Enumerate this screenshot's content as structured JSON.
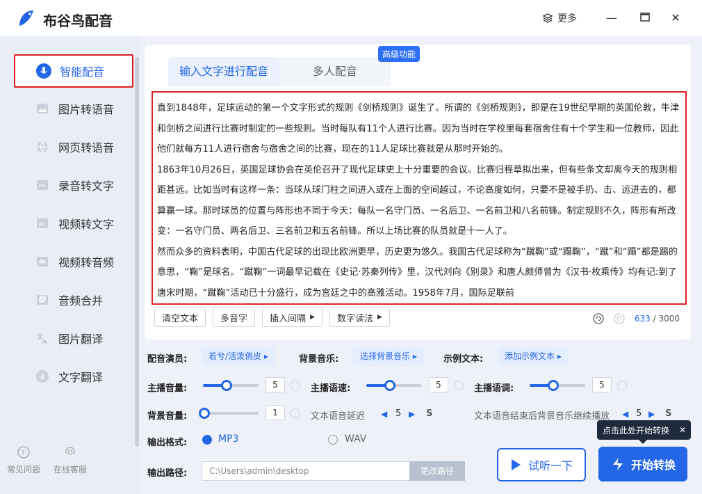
{
  "app": {
    "title": "布谷鸟配音",
    "more_label": "更多"
  },
  "sidebar": {
    "items": [
      {
        "label": "智能配音",
        "icon": "mic-icon"
      },
      {
        "label": "图片转语音",
        "icon": "image-icon"
      },
      {
        "label": "网页转语音",
        "icon": "globe-icon"
      },
      {
        "label": "录音转文字",
        "icon": "text-doc-icon"
      },
      {
        "label": "视频转文字",
        "icon": "text-doc-icon"
      },
      {
        "label": "视频转音频",
        "icon": "audio-wave-icon"
      },
      {
        "label": "音频合并",
        "icon": "merge-icon"
      },
      {
        "label": "图片翻译",
        "icon": "translate-icon"
      },
      {
        "label": "文字翻译",
        "icon": "translate-circle-icon"
      }
    ],
    "bottom": [
      {
        "label": "常见问题"
      },
      {
        "label": "在线客服"
      }
    ]
  },
  "tabs": [
    {
      "label": "输入文字进行配音"
    },
    {
      "label": "多人配音"
    }
  ],
  "badge": "高级功能",
  "content": {
    "paragraphs": [
      "直到1848年，足球运动的第一个文字形式的规则《剑桥规则》诞生了。所谓的《剑桥规则》，即是在19世纪早期的英国伦敦，牛津和剑桥之间进行比赛时制定的一些规则。当时每队有11个人进行比赛。因为当时在学校里每套宿舍住有十个学生和一位教师，因此他们就每方11人进行宿舍与宿舍之间的比赛，现在的11人足球比赛就是从那时开始的。",
      "1863年10月26日，英国足球协会在英伦召开了现代足球史上十分重要的会议。比赛归程草拟出来，但有些条文却离今天的规则相距甚远。比如当时有这样一条：当球从球门柱之间进入或在上面的空间越过，不论高度如何，只要不是被手扔、击、运进去的，都算赢一球。那时球员的位置与阵形也不同于今天：每队一名守门员、一名后卫、一名前卫和八名前锋。制定规则不久，阵形有所改变：一名守门员、两名后卫、三名前卫和五名前锋。所以上场比赛的队员就是十一人了。",
      "然而众多的资料表明，中国古代足球的出现比欧洲更早，历史更为悠久。我国古代足球称为“蹴鞠”或“蹋鞠”，“蹴”和“蹋”都是踢的意思，“鞠”是球名。“蹴鞠”一词最早记载在《史记·苏秦列传》里，汉代刘向《别录》和唐人颜师曾为《汉书·枚乘传》均有记:到了唐宋时期，“蹴鞠”活动已十分盛行，成为宫廷之中的高雅活动。1958年7月，国际足联前"
    ]
  },
  "tools": {
    "clear": "清空文本",
    "polyphone": "多音字",
    "insert_pause": "插入间隔",
    "number_read": "数字读法"
  },
  "counter": {
    "current": "633",
    "max": "/ 3000"
  },
  "settings": {
    "voice_label": "配音演员:",
    "voice_value": "若兮/活泼俏皮",
    "bgm_label": "背景音乐:",
    "bgm_value": "选择背景音乐",
    "sample_label": "示例文本:",
    "sample_value": "添加示例文本",
    "volume_label": "主播音量:",
    "volume_value": "5",
    "speed_label": "主播语速:",
    "speed_value": "5",
    "pitch_label": "主播语调:",
    "pitch_value": "5",
    "bg_volume_label": "背景音量:",
    "bg_volume_value": "1",
    "delay_label": "文本语音延迟",
    "delay_value": "5",
    "delay_unit": "S",
    "tail_label": "文本语音结束后背景音乐继续播放",
    "tail_value": "5",
    "tail_unit": "S",
    "format_label": "输出格式:",
    "format_mp3": "MP3",
    "format_wav": "WAV",
    "path_label": "输出路径:",
    "path_value": "C:\\Users\\admin\\desktop",
    "path_button": "更改路径"
  },
  "actions": {
    "listen": "试听一下",
    "start": "开始转换",
    "tip": "点击此处开始转换"
  },
  "colors": {
    "accent": "#2466e8",
    "highlight_border": "#e02020"
  }
}
